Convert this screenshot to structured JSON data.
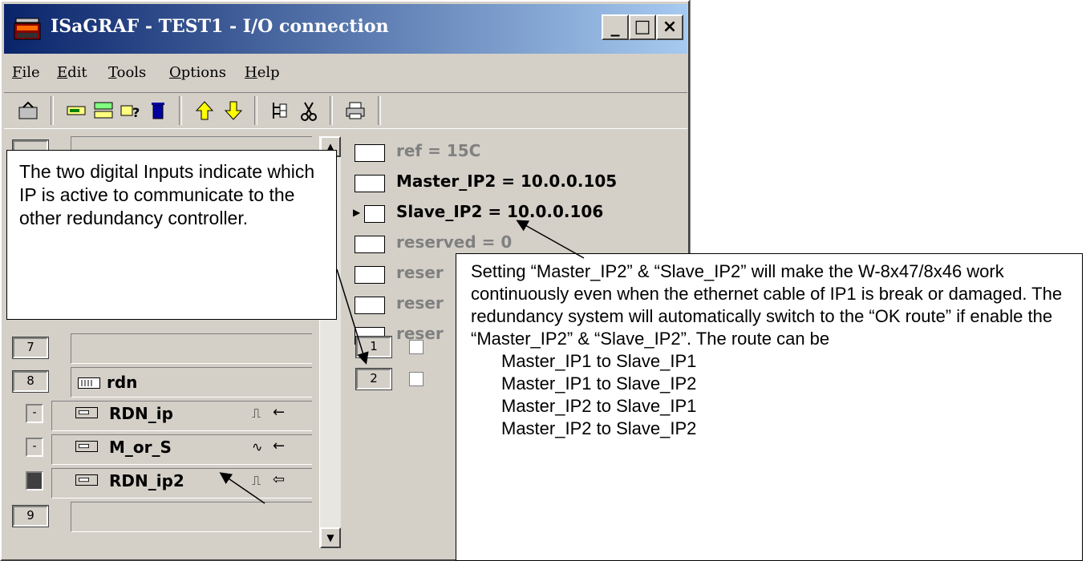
{
  "window": {
    "title": "ISaGRAF - TEST1 - I/O connection",
    "controls": {
      "minimize": "_",
      "maximize": "□",
      "close": "×"
    }
  },
  "menu": [
    {
      "label": "File"
    },
    {
      "label": "Edit"
    },
    {
      "label": "Tools"
    },
    {
      "label": "Options"
    },
    {
      "label": "Help"
    }
  ],
  "toolbar_icons": [
    "open-icon",
    "board-icon",
    "board-list-icon",
    "board-info-icon",
    "delete-icon",
    "move-up-icon",
    "move-down-icon",
    "tree-icon",
    "cut-icon",
    "print-icon"
  ],
  "slots": [
    {
      "number": "7",
      "board": ""
    },
    {
      "number": "8",
      "board": "rdn"
    },
    {
      "number": "9",
      "board": ""
    }
  ],
  "board_variables": [
    {
      "marker": "-",
      "name": "RDN_ip",
      "signal": "⎍",
      "arrow": "←"
    },
    {
      "marker": "-",
      "name": "M_or_S",
      "signal": "∿",
      "arrow": "←"
    },
    {
      "marker": "",
      "name": "RDN_ip2",
      "signal": "⎍",
      "arrow": "⇦"
    }
  ],
  "parameters": [
    {
      "text": "ref = 15C"
    },
    {
      "text": "Master_IP2 = 10.0.0.105"
    },
    {
      "text": "Slave_IP2 = 10.0.0.106"
    },
    {
      "text": "reserved = 0"
    },
    {
      "text": "reser"
    },
    {
      "text": "reser"
    },
    {
      "text": "reser"
    }
  ],
  "channels": [
    {
      "number": "1"
    },
    {
      "number": "2"
    }
  ],
  "callouts": {
    "left": "The two digital Inputs indicate which IP is active to communicate to the other redundancy controller.",
    "right": "Setting “Master_IP2” & “Slave_IP2” will make the W-8x47/8x46 work continuously even when the ethernet cable of IP1 is break or damaged. The redundancy system will automatically switch to the “OK route” if enable the  “Master_IP2” & “Slave_IP2”. The route can be",
    "routes": [
      "Master_IP1 to Slave_IP1",
      "Master_IP1 to Slave_IP2",
      "Master_IP2 to Slave_IP1",
      "Master_IP2 to Slave_IP2"
    ]
  },
  "colors": {
    "titlebar_start": "#0a246a",
    "titlebar_end": "#a6caf0",
    "face": "#d4d0c8"
  }
}
